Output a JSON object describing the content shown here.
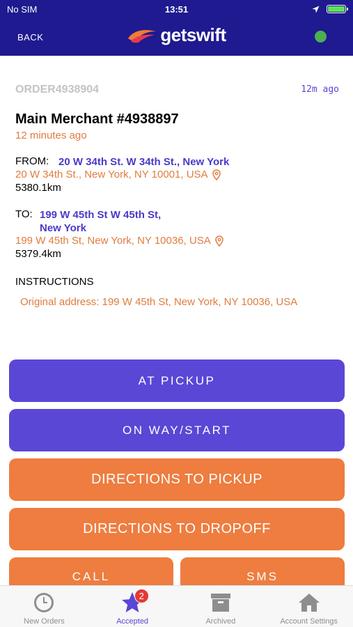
{
  "status_bar": {
    "carrier": "No SIM",
    "time": "13:51"
  },
  "header": {
    "back_label": "BACK",
    "logo_text": "getswift",
    "online_status_color": "#4caf50",
    "brand_color": "#1f1a8f"
  },
  "order": {
    "id": "ORDER4938904",
    "age": "12m ago",
    "merchant": "Main Merchant #4938897",
    "merchant_time": "12 minutes ago"
  },
  "from": {
    "label": "FROM:",
    "title": "20 W 34th St. W 34th St., New York",
    "address": "20 W 34th St., New York, NY 10001, USA",
    "distance": "5380.1km"
  },
  "to": {
    "label": "TO:",
    "title_line1": "199 W 45th St W 45th St,",
    "title_line2": "New York",
    "address": "199 W 45th St, New York, NY 10036, USA",
    "distance": "5379.4km"
  },
  "instructions": {
    "label": "INSTRUCTIONS",
    "text": "Original address: 199 W 45th St, New York, NY 10036, USA"
  },
  "actions": {
    "at_pickup": "AT PICKUP",
    "on_way": "ON WAY/START",
    "directions_pickup": "DIRECTIONS TO PICKUP",
    "directions_dropoff": "DIRECTIONS TO DROPOFF",
    "call": "CALL",
    "sms": "SMS"
  },
  "tabs": [
    {
      "label": "New Orders",
      "icon": "clock-icon"
    },
    {
      "label": "Accepted",
      "icon": "star-icon",
      "badge": "2"
    },
    {
      "label": "Archived",
      "icon": "archive-box-icon"
    },
    {
      "label": "Account Settings",
      "icon": "home-icon"
    }
  ],
  "colors": {
    "accent_purple": "#5a47d6",
    "accent_orange": "#ee7d3f",
    "address_orange": "#e07c3e"
  }
}
